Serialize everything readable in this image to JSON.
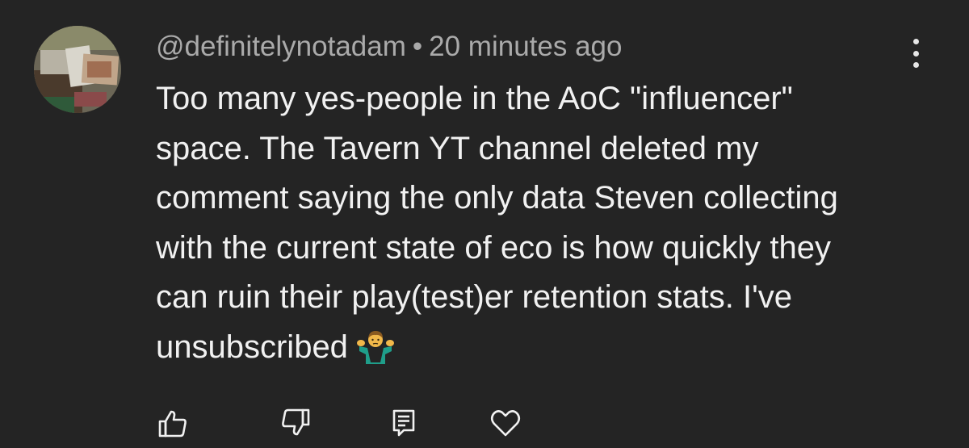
{
  "comment": {
    "author": "@definitelynotadam",
    "separator": "•",
    "time": "20 minutes ago",
    "lines": [
      "Too many yes-people in the AoC \"influencer\"",
      "space. The Tavern YT channel deleted my",
      "comment saying the only data Steven collecting",
      "with the current state of eco is how quickly they",
      "can ruin their play(test)er retention stats. I've",
      "unsubscribed"
    ],
    "emoji": "person-shrugging-emoji"
  },
  "icons": {
    "more": "vertical-ellipsis-icon",
    "like": "thumbs-up-icon",
    "dislike": "thumbs-down-icon",
    "reply": "reply-comment-icon",
    "heart": "heart-icon"
  },
  "colors": {
    "background": "#242424",
    "text": "#f1f1f1",
    "meta": "#aaaaaa",
    "icon": "#f1f1f1"
  }
}
